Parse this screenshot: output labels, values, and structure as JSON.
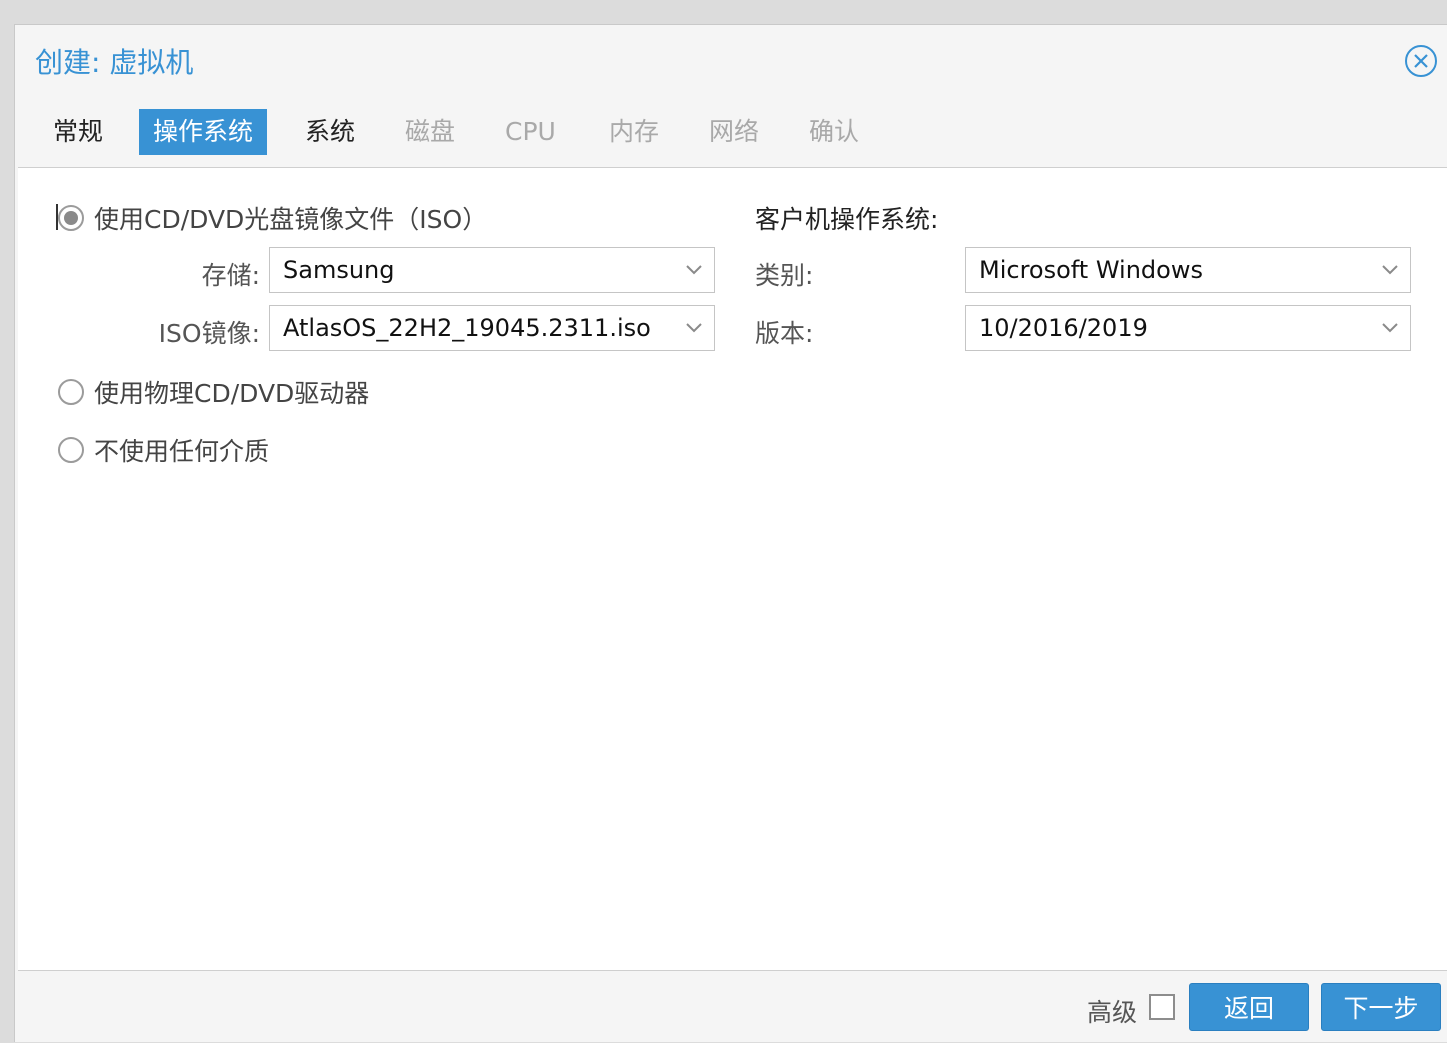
{
  "dialog": {
    "title": "创建: 虚拟机"
  },
  "icons": {
    "close": "close-circle-icon",
    "dropdown": "chevron-down-icon"
  },
  "colors": {
    "accent": "#3892d4",
    "disabled_tab": "#a9a9a9"
  },
  "tabs": [
    {
      "label": "常规",
      "state": "normal"
    },
    {
      "label": "操作系统",
      "state": "active"
    },
    {
      "label": "系统",
      "state": "normal"
    },
    {
      "label": "磁盘",
      "state": "disabled"
    },
    {
      "label": "CPU",
      "state": "disabled"
    },
    {
      "label": "内存",
      "state": "disabled"
    },
    {
      "label": "网络",
      "state": "disabled"
    },
    {
      "label": "确认",
      "state": "disabled"
    }
  ],
  "media": {
    "iso_option": {
      "label": "使用CD/DVD光盘镜像文件（ISO）",
      "checked": true
    },
    "storage": {
      "label": "存储:",
      "value": "Samsung"
    },
    "iso_image": {
      "label": "ISO镜像:",
      "value": "AtlasOS_22H2_19045.2311.iso"
    },
    "physical_option": {
      "label": "使用物理CD/DVD驱动器",
      "checked": false
    },
    "none_option": {
      "label": "不使用任何介质",
      "checked": false
    }
  },
  "guest_os": {
    "title": "客户机操作系统:",
    "type": {
      "label": "类别:",
      "value": "Microsoft Windows"
    },
    "version": {
      "label": "版本:",
      "value": "10/2016/2019"
    }
  },
  "footer": {
    "advanced_label": "高级",
    "advanced_checked": false,
    "back_label": "返回",
    "next_label": "下一步"
  }
}
